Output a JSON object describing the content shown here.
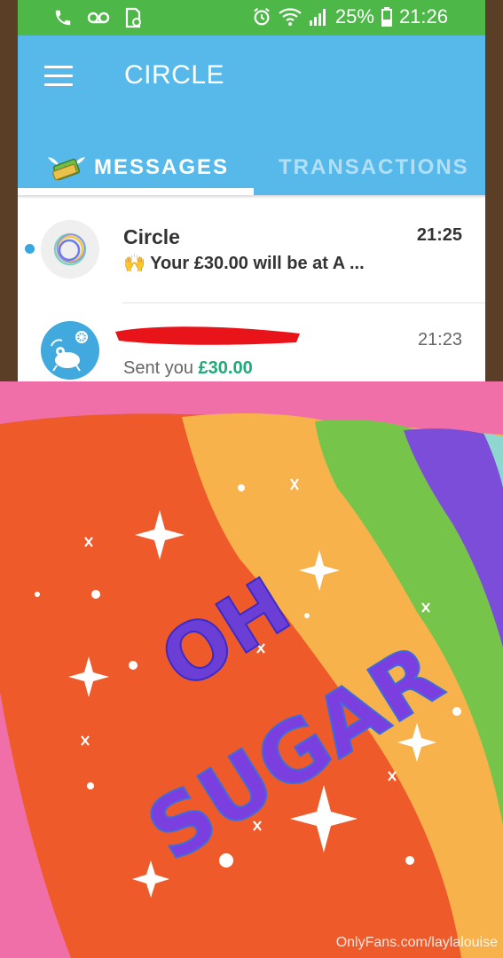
{
  "status_bar": {
    "icons_left": [
      "phone-icon",
      "voicemail-icon",
      "sim-alert-icon"
    ],
    "icons_right": [
      "alarm-icon",
      "wifi-icon",
      "signal-icon"
    ],
    "battery": "25%",
    "clock": "21:26"
  },
  "app_bar": {
    "title": "CIRCLE",
    "tabs": [
      {
        "label": "MESSAGES",
        "active": true,
        "icon": "money-wings-icon"
      },
      {
        "label": "TRANSACTIONS",
        "active": false
      }
    ]
  },
  "messages": [
    {
      "name": "Circle",
      "time": "21:25",
      "unread": true,
      "emoji": "🙌",
      "preview": "Your £30.00 will be at A ...",
      "avatar": "circle-logo-icon"
    },
    {
      "name": "",
      "name_redacted": true,
      "time": "21:23",
      "preview_prefix": "Sent you ",
      "amount": "£30.00",
      "avatar": "creature-avatar-icon"
    }
  ],
  "overlay": {
    "line1": "OH",
    "line2": "SUGAR",
    "watermark": "OnlyFans.com/laylalouise"
  },
  "colors": {
    "status_green": "#4db848",
    "app_blue": "#56b9ea",
    "amount_green": "#1faa7a",
    "rainbow": [
      "#f0623b",
      "#f7b24c",
      "#76c54a",
      "#7b4dd8"
    ]
  }
}
